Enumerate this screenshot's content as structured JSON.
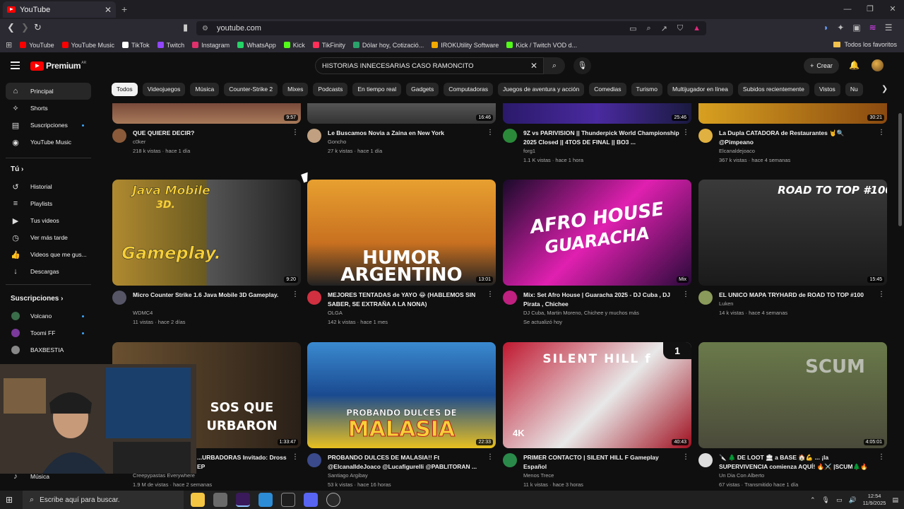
{
  "browser": {
    "tab_title": "YouTube",
    "url": "youtube.com",
    "bookmarks": [
      {
        "label": "YouTube",
        "color": "#ff0000"
      },
      {
        "label": "YouTube Music",
        "color": "#ff0000"
      },
      {
        "label": "TikTok",
        "color": "#ffffff"
      },
      {
        "label": "Twitch",
        "color": "#9146ff"
      },
      {
        "label": "Instagram",
        "color": "#e1306c"
      },
      {
        "label": "WhatsApp",
        "color": "#25d366"
      },
      {
        "label": "Kick",
        "color": "#53fc18"
      },
      {
        "label": "TikFinity",
        "color": "#ff2f5a"
      },
      {
        "label": "Dólar hoy, Cotizació...",
        "color": "#2aa36b"
      },
      {
        "label": "IROKUtility Software",
        "color": "#f2a900"
      },
      {
        "label": "Kick / Twitch VOD d...",
        "color": "#53fc18"
      }
    ],
    "bookmarks_folder": "Todos los favoritos"
  },
  "header": {
    "logo_text": "Premium",
    "logo_country": "AR",
    "search_value": "HISTORIAS INNECESARIAS CASO RAMONCITO",
    "create_label": "Crear"
  },
  "chips": [
    "Todos",
    "Videojuegos",
    "Música",
    "Counter-Strike 2",
    "Mixes",
    "Podcasts",
    "En tiempo real",
    "Gadgets",
    "Computadoras",
    "Juegos de aventura y acción",
    "Comedias",
    "Turismo",
    "Multijugador en línea",
    "Subidos recientemente",
    "Vistos",
    "Nu"
  ],
  "sidebar": {
    "main": [
      {
        "label": "Principal",
        "icon": "home-icon"
      },
      {
        "label": "Shorts",
        "icon": "shorts-icon"
      },
      {
        "label": "Suscripciones",
        "icon": "subscriptions-icon"
      },
      {
        "label": "YouTube Music",
        "icon": "music-icon"
      }
    ],
    "you_heading": "Tú",
    "you": [
      {
        "label": "Historial",
        "icon": "history-icon"
      },
      {
        "label": "Playlists",
        "icon": "playlist-icon"
      },
      {
        "label": "Tus videos",
        "icon": "video-icon"
      },
      {
        "label": "Ver más tarde",
        "icon": "clock-icon"
      },
      {
        "label": "Videos que me gus...",
        "icon": "like-icon"
      },
      {
        "label": "Descargas",
        "icon": "download-icon"
      }
    ],
    "subs_heading": "Suscripciones",
    "subs": [
      {
        "label": "Volcano",
        "color": "#3a6d4a"
      },
      {
        "label": "Toomi FF",
        "color": "#7a3a9a"
      },
      {
        "label": "BAXBESTIA",
        "color": "#888888"
      }
    ],
    "bottom": {
      "label": "Música",
      "icon": "music-note-icon"
    }
  },
  "videos_row1": [
    {
      "title": "QUE QUIERE DECIR?",
      "channel": "c0ker",
      "meta": "218 k vistas · hace 1 día",
      "duration": "9:57"
    },
    {
      "title": "Le Buscamos Novia a Zaina en New York",
      "channel": "Goncho",
      "meta": "27 k vistas · hace 1 día",
      "duration": "16:46"
    },
    {
      "title": "9Z vs PARIVISION || Thunderpick World Championship 2025 Closed || 4TOS DE FINAL || BO3 ...",
      "channel": "forg1",
      "meta": "1.1 K vistas · hace 1 hora",
      "duration": "25:46"
    },
    {
      "title": "La Dupla CATADORA de Restaurantes 🤘🔍 @Pimpeano",
      "channel": "Elcanaldejoaco",
      "meta": "367 k vistas · hace 4 semanas",
      "duration": "30:21"
    }
  ],
  "videos_row2": [
    {
      "title": "Micro Counter Strike 1.6 Java Mobile 3D Gameplay.",
      "channel": "WDMC4",
      "meta": "11 vistas · hace 2 días",
      "duration": "9:20",
      "thumb_top": "Java Mobile",
      "thumb_sub": "3D.",
      "thumb_bottom": "Gameplay."
    },
    {
      "title": "MEJORES TENTADAS de YAYO 😂 (HABLEMOS SIN SABER, SE EXTRAÑA A LA NONA)",
      "channel": "OLGA",
      "meta": "142 k vistas · hace 1 mes",
      "duration": "13:01",
      "thumb_top": "HUMOR",
      "thumb_bottom": "ARGENTINO"
    },
    {
      "title": "Mix: Set Afro House | Guaracha 2025 - DJ Cuba , DJ Pirata , Chichee",
      "channel": "DJ Cuba, Martin Moreno, Chichee y muchos más",
      "meta": "Se actualizó hoy",
      "duration": "Mix",
      "thumb_top": "AFRO HOUSE",
      "thumb_bottom": "GUARACHA"
    },
    {
      "title": "EL UNICO MAPA TRYHARD de ROAD TO TOP #100",
      "channel": "Luken",
      "meta": "14 k vistas · hace 4 semanas",
      "duration": "15:45",
      "thumb_top": "ROAD TO TOP #100"
    }
  ],
  "videos_row3": [
    {
      "title": "...URBADORAS Invitado: Dross EP",
      "channel": "Creepypastas Everywhere",
      "meta": "1.9 M de vistas · hace 2 semanas",
      "duration": "1:33:47",
      "thumb_top": "SOS QUE",
      "thumb_bottom": "URBARON"
    },
    {
      "title": "PROBANDO DULCES DE MALASIA!! Ft @ElcanalldeJoaco @Lucafigurelli @PABLITORAN ...",
      "channel": "Santiago Argibay",
      "meta": "53 k vistas · hace 16 horas",
      "duration": "22:33",
      "thumb_top": "PROBANDO DULCES DE",
      "thumb_bottom": "MALASIA"
    },
    {
      "title": "PRIMER CONTACTO | SILENT HILL F Gameplay Español",
      "channel": "Menos Trece",
      "meta": "11 k vistas · hace 3 horas",
      "duration": "40:43",
      "thumb_top": "SILENT HILL f",
      "thumb_badge": "4K",
      "thumb_num": "1"
    },
    {
      "title": "🔪 🌲 DE LOOT 🏛 a BASE 🏠💪 ... ¡la SUPERVIVENCIA comienza AQUÍ! 🔥⚔️ |SCUM🌲🔥",
      "channel": "Un Dia Con Alberto",
      "meta": "67 vistas · Transmitido hace 1 día",
      "duration": "4:05:01",
      "thumb_top": "SCUM"
    }
  ],
  "taskbar": {
    "search_placeholder": "Escribe aquí para buscar.",
    "time": "12:54",
    "date": "11/9/2025"
  }
}
